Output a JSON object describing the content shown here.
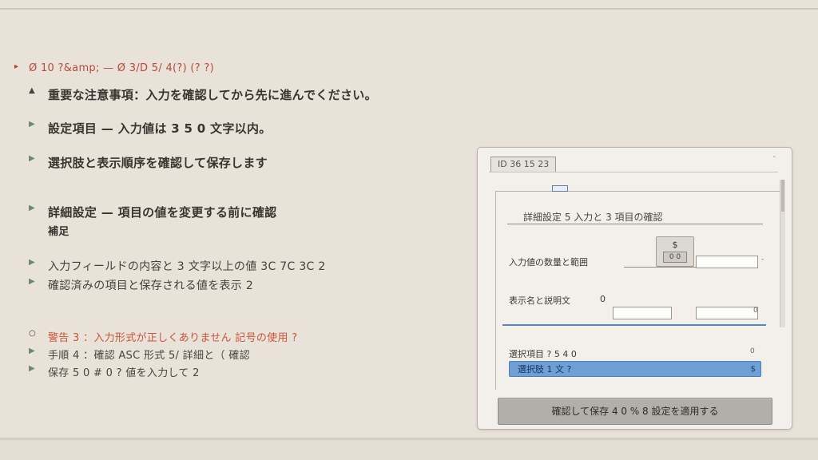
{
  "left_panel": {
    "heading": "Ø 10 ?&amp; — Ø 3/D 5/ 4(?) (? ?)",
    "items": [
      {
        "bullet": "▲",
        "text": "重要な注意事項：入力を確認してから先に進んでください。"
      },
      {
        "bullet": "▶",
        "text": "設定項目 — 入力値は 3 5 0 文字以内。"
      },
      {
        "bullet": "▶",
        "text": "選択肢と表示順序を確認して保存します"
      },
      {
        "bullet": "▶",
        "text": "詳細設定 — 項目の値を変更する前に確認",
        "text2": "補足"
      },
      {
        "bullet": "▶",
        "text": "入力フィールドの内容と 3 文字以上の値 3C 7C 3C 2"
      },
      {
        "bullet": "▶",
        "text": "確認済みの項目と保存される値を表示 2"
      },
      {
        "bullet": "○",
        "text": "警告 3 ：入力形式が正しくありません 記号の使用 ?",
        "warn": true
      },
      {
        "bullet": "▶",
        "text": "手順 4 ：確認 ASC 形式 5/ 詳細と（ 確認"
      },
      {
        "bullet": "▶",
        "text": "保存 5 0 # 0 ? 値を入力して 2"
      }
    ]
  },
  "dialog": {
    "title": "ID 36 15 23",
    "menu_glyph": "-",
    "section_title": "詳細設定 5 入力と 3 項目の確認",
    "fields": [
      {
        "label": "入力値の数量と範囲",
        "spin_symbol": "$",
        "spin_value": "0 0",
        "input_value": "",
        "end_glyph": "-"
      },
      {
        "label": "表示名と説明文",
        "inline_glyph": "0",
        "input_value": "",
        "end_glyph": "0"
      },
      {
        "label": "選択項目 ? 5 4 0",
        "end_glyph": "0"
      }
    ],
    "select": {
      "value": "選択肢 1 文 ?",
      "arrow": "$"
    },
    "primary_button": "確認して保存 4 0 % 8 設定を適用する"
  }
}
